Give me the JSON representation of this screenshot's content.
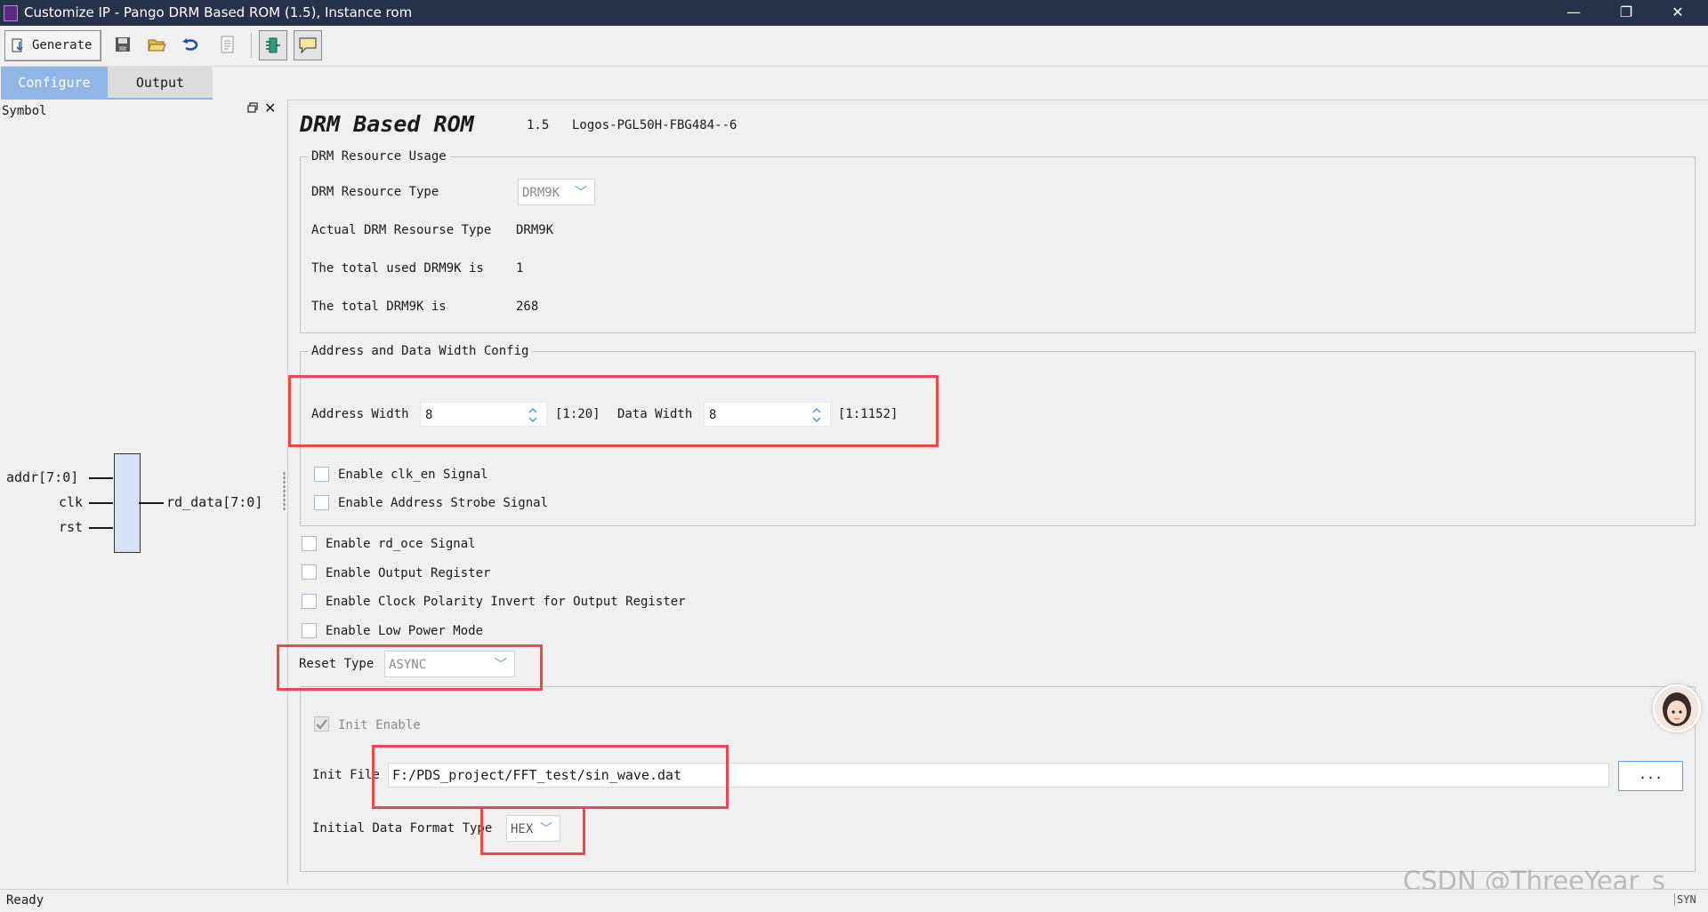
{
  "window": {
    "title": "Customize IP - Pango DRM Based ROM (1.5), Instance rom",
    "minimize_glyph": "—",
    "restore_glyph": "❐",
    "close_glyph": "✕"
  },
  "toolbar": {
    "generate_label": "Generate",
    "icons": [
      "generate-icon",
      "save-icon",
      "open-folder-icon",
      "refresh-icon",
      "document-icon",
      "symbol-view-icon",
      "comment-icon"
    ]
  },
  "tabs": [
    {
      "label": "Configure",
      "active": true
    },
    {
      "label": "Output",
      "active": false
    }
  ],
  "symbol_panel": {
    "title": "Symbol",
    "close_glyph": "✕",
    "inputs": [
      "addr[7:0]",
      "clk",
      "rst"
    ],
    "output": "rd_data[7:0]"
  },
  "header": {
    "title": "DRM Based ROM",
    "version": "1.5",
    "device": "Logos-PGL50H-FBG484--6"
  },
  "drm_usage": {
    "legend": "DRM Resource Usage",
    "resource_type_label": "DRM Resource Type",
    "resource_type_value": "DRM9K",
    "actual_label": "Actual DRM Resourse Type",
    "actual_value": "DRM9K",
    "used_label": "The total used DRM9K is",
    "used_value": "1",
    "total_label": "The total DRM9K is",
    "total_value": "268"
  },
  "width_config": {
    "legend": "Address and Data Width Config",
    "address_width_label": "Address Width",
    "address_width_value": "8",
    "address_range": "[1:20]",
    "data_width_label": "Data Width",
    "data_width_value": "8",
    "data_range": "[1:1152]",
    "enable_clk_en": "Enable clk_en Signal",
    "enable_addr_strobe": "Enable Address Strobe Signal"
  },
  "options": {
    "rd_oce": "Enable rd_oce Signal",
    "output_register": "Enable Output Register",
    "clock_polarity": "Enable Clock Polarity Invert for Output Register",
    "low_power": "Enable Low Power Mode",
    "reset_type_label": "Reset Type",
    "reset_type_value": "ASYNC"
  },
  "init": {
    "init_enable_label": "Init Enable",
    "init_enable_checked": true,
    "init_file_label": "Init File",
    "init_file_value": "F:/PDS_project/FFT_test/sin_wave.dat",
    "browse_label": "...",
    "format_label": "Initial Data Format Type",
    "format_value": "HEX"
  },
  "watermark": "CSDN @ThreeYear_s",
  "status": {
    "text": "Ready",
    "right": "SYN"
  },
  "colors": {
    "annotation": "#e8494d",
    "tab_active": "#8fb6e6",
    "titlebar": "#26324a"
  }
}
